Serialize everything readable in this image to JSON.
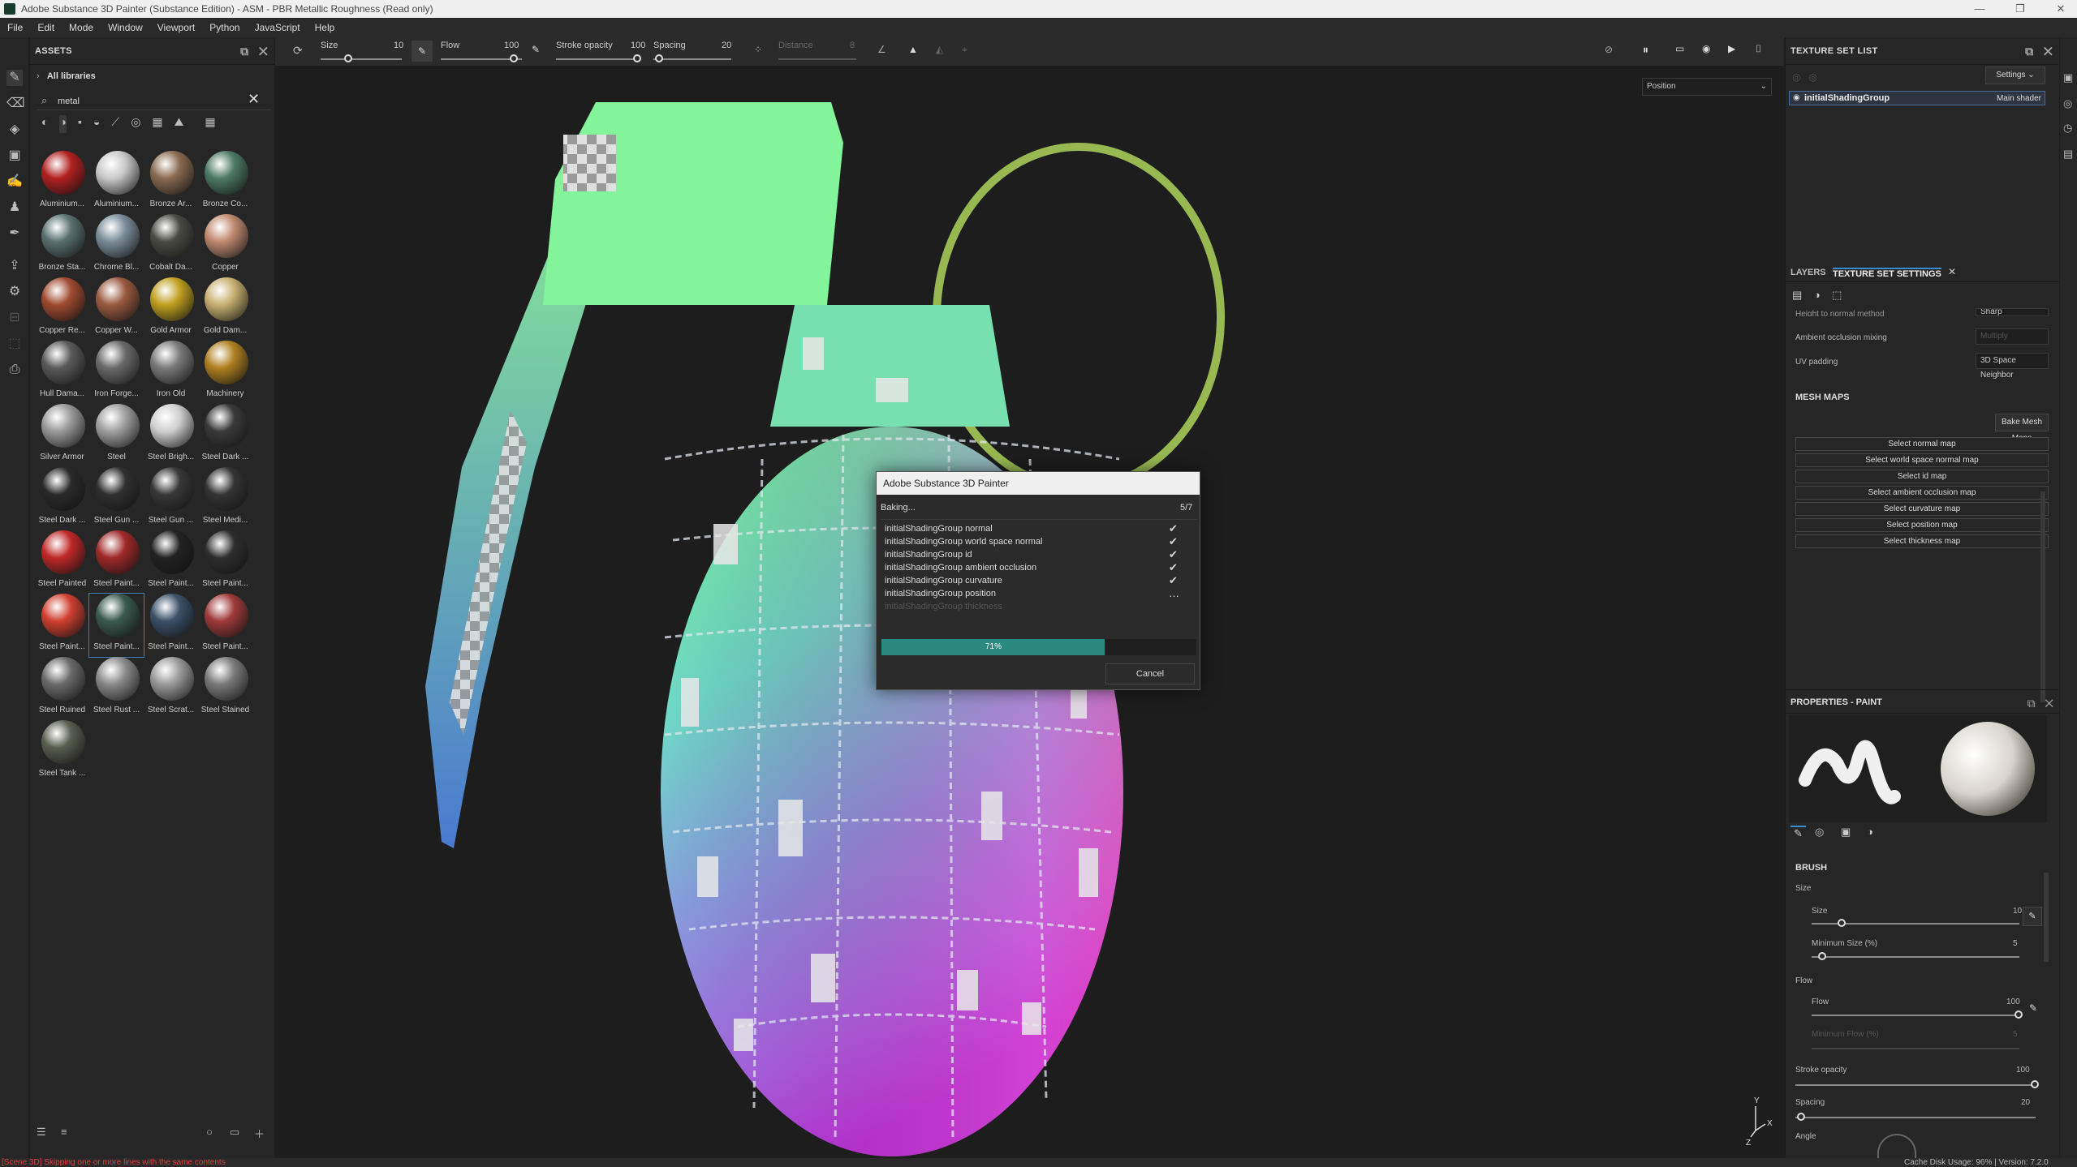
{
  "window": {
    "title": "Adobe Substance 3D Painter (Substance Edition) - ASM - PBR Metallic Roughness (Read only)"
  },
  "menu": [
    "File",
    "Edit",
    "Mode",
    "Window",
    "Viewport",
    "Python",
    "JavaScript",
    "Help"
  ],
  "assets": {
    "title": "ASSETS",
    "library": "All libraries",
    "search_value": "metal",
    "materials": [
      {
        "label": "Aluminium...",
        "color": "#b22020"
      },
      {
        "label": "Aluminium...",
        "color": "#c9c9c9"
      },
      {
        "label": "Bronze Ar...",
        "color": "#8a6a50"
      },
      {
        "label": "Bronze Co...",
        "color": "#4d7a65"
      },
      {
        "label": "Bronze Sta...",
        "color": "#5a7070"
      },
      {
        "label": "Chrome Bl...",
        "color": "#7a8c98"
      },
      {
        "label": "Cobalt Da...",
        "color": "#4a4a44"
      },
      {
        "label": "Copper",
        "color": "#c08a70"
      },
      {
        "label": "Copper Re...",
        "color": "#a04a30"
      },
      {
        "label": "Copper W...",
        "color": "#9a5a40"
      },
      {
        "label": "Gold Armor",
        "color": "#c0a020"
      },
      {
        "label": "Gold Dam...",
        "color": "#c8b070"
      },
      {
        "label": "Hull Dama...",
        "color": "#5a5a5a"
      },
      {
        "label": "Iron Forge...",
        "color": "#6a6a6a"
      },
      {
        "label": "Iron Old",
        "color": "#7a7a7a"
      },
      {
        "label": "Machinery",
        "color": "#b08020"
      },
      {
        "label": "Silver Armor",
        "color": "#9a9a9a"
      },
      {
        "label": "Steel",
        "color": "#a0a0a0"
      },
      {
        "label": "Steel Brigh...",
        "color": "#d0d0d0"
      },
      {
        "label": "Steel Dark ...",
        "color": "#3a3a3a"
      },
      {
        "label": "Steel Dark ...",
        "color": "#2a2a2a"
      },
      {
        "label": "Steel Gun ...",
        "color": "#303030"
      },
      {
        "label": "Steel Gun ...",
        "color": "#383838"
      },
      {
        "label": "Steel Medi...",
        "color": "#343434"
      },
      {
        "label": "Steel Painted",
        "color": "#c02828"
      },
      {
        "label": "Steel Paint...",
        "color": "#a02828"
      },
      {
        "label": "Steel Paint...",
        "color": "#222222"
      },
      {
        "label": "Steel Paint...",
        "color": "#2e2e2e"
      },
      {
        "label": "Steel Paint...",
        "color": "#d04030"
      },
      {
        "label": "Steel Paint...",
        "color": "#3a5a50"
      },
      {
        "label": "Steel Paint...",
        "color": "#3a5068"
      },
      {
        "label": "Steel Paint...",
        "color": "#a03a3a"
      },
      {
        "label": "Steel Ruined",
        "color": "#6a6a6a"
      },
      {
        "label": "Steel Rust ...",
        "color": "#8a8a8a"
      },
      {
        "label": "Steel Scrat...",
        "color": "#9a9a9a"
      },
      {
        "label": "Steel Stained",
        "color": "#7a7a7a"
      },
      {
        "label": "Steel Tank ...",
        "color": "#5a5e50"
      }
    ]
  },
  "toolbar": {
    "size_label": "Size",
    "size_value": "10",
    "flow_label": "Flow",
    "flow_value": "100",
    "stroke_label": "Stroke opacity",
    "stroke_value": "100",
    "spacing_label": "Spacing",
    "spacing_value": "20",
    "distance_label": "Distance",
    "distance_value": "8"
  },
  "viewport": {
    "channel_select": "Position"
  },
  "texture_set_list": {
    "title": "TEXTURE SET LIST",
    "settings": "Settings",
    "item": "initialShadingGroup",
    "shader": "Main shader"
  },
  "tabs": {
    "layers": "LAYERS",
    "texture_set_settings": "TEXTURE SET SETTINGS"
  },
  "tss": {
    "height_normal_label": "Height to normal method",
    "height_normal_value": "Sharp",
    "ao_mixing_label": "Ambient occlusion mixing",
    "ao_mixing_value": "Multiply",
    "uv_padding_label": "UV padding",
    "uv_padding_value": "3D Space Neighbor",
    "mesh_maps_title": "MESH MAPS",
    "bake_button": "Bake Mesh Maps",
    "maps": [
      "Select normal map",
      "Select world space normal map",
      "Select id map",
      "Select ambient occlusion map",
      "Select curvature map",
      "Select position map",
      "Select thickness map"
    ]
  },
  "properties": {
    "title": "PROPERTIES - PAINT",
    "brush_title": "BRUSH",
    "size_group": "Size",
    "size_label": "Size",
    "size_value": "10",
    "min_size_label": "Minimum Size (%)",
    "min_size_value": "5",
    "flow_group": "Flow",
    "flow_label": "Flow",
    "flow_value": "100",
    "min_flow_label": "Minimum Flow (%)",
    "min_flow_value": "5",
    "stroke_label": "Stroke opacity",
    "stroke_value": "100",
    "spacing_label": "Spacing",
    "spacing_value": "20",
    "angle_label": "Angle"
  },
  "dialog": {
    "title": "Adobe Substance 3D Painter",
    "status": "Baking...",
    "count": "5/7",
    "items": [
      {
        "label": "initialShadingGroup normal",
        "done": true
      },
      {
        "label": "initialShadingGroup world space normal",
        "done": true
      },
      {
        "label": "initialShadingGroup id",
        "done": true
      },
      {
        "label": "initialShadingGroup ambient occlusion",
        "done": true
      },
      {
        "label": "initialShadingGroup curvature",
        "done": true
      },
      {
        "label": "initialShadingGroup position",
        "done": false
      },
      {
        "label": "initialShadingGroup thickness",
        "done": false
      }
    ],
    "progress": 0.71,
    "progress_text": "71%",
    "cancel": "Cancel"
  },
  "status": {
    "message": "[Scene 3D] Skipping one or more lines with the same contents",
    "right": "Cache Disk Usage:   96% | Version: 7.2.0"
  }
}
